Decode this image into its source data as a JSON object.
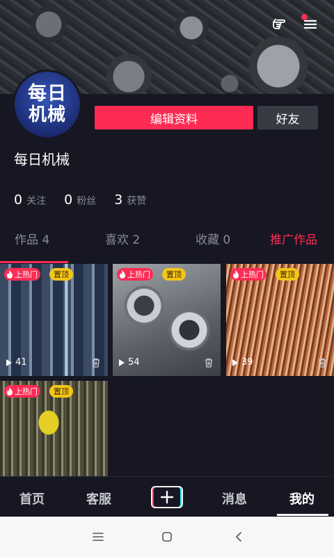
{
  "profile": {
    "avatar_text_line1": "每日",
    "avatar_text_line2": "机械",
    "username": "每日机械",
    "edit_label": "编辑资料",
    "friends_label": "好友"
  },
  "stats": [
    {
      "value": "0",
      "label": "关注"
    },
    {
      "value": "0",
      "label": "粉丝"
    },
    {
      "value": "3",
      "label": "获赞"
    }
  ],
  "tabs": [
    {
      "label": "作品 4"
    },
    {
      "label": "喜欢 2"
    },
    {
      "label": "收藏 0"
    },
    {
      "label": "推广作品"
    }
  ],
  "videos": [
    {
      "hot_label": "上热门",
      "top_label": "置顶",
      "plays": "41"
    },
    {
      "hot_label": "上热门",
      "top_label": "置顶",
      "plays": "54"
    },
    {
      "hot_label": "上热门",
      "top_label": "置顶",
      "plays": "39"
    },
    {
      "hot_label": "上热门",
      "top_label": "置顶",
      "plays": ""
    }
  ],
  "bottom_nav": {
    "home": "首页",
    "service": "客服",
    "messages": "消息",
    "me": "我的"
  },
  "colors": {
    "accent": "#fe2c55",
    "background": "#161722",
    "badge_top": "#f5c518"
  }
}
